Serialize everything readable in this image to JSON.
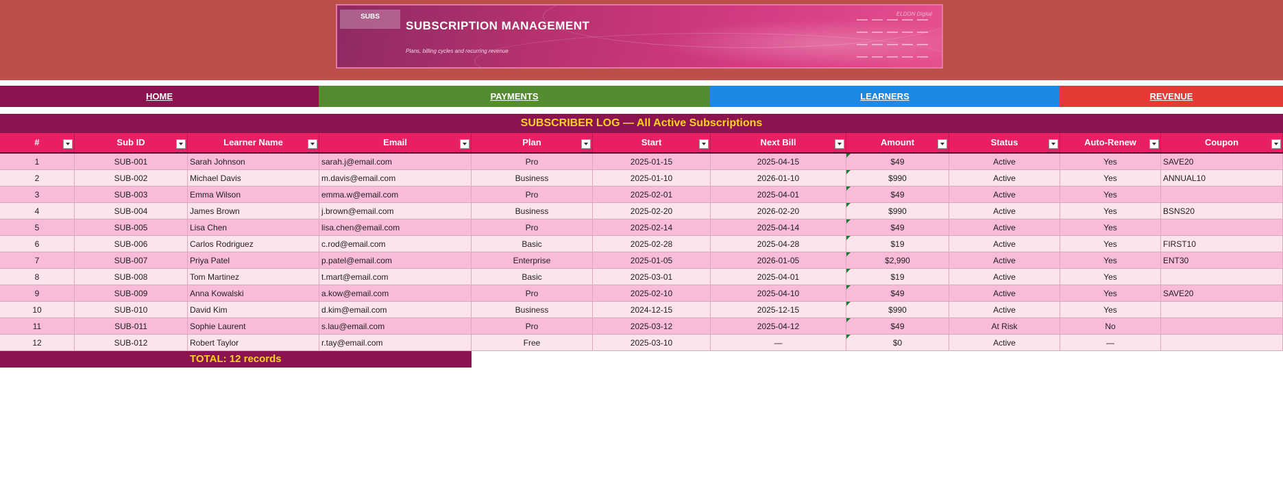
{
  "banner": {
    "badge": "SUBS",
    "title": "SUBSCRIPTION MANAGEMENT",
    "subtitle": "Plans, billing cycles and recurring revenue",
    "brand": "ELDON Digital"
  },
  "nav": {
    "home": "HOME",
    "payments": "PAYMENTS",
    "learners": "LEARNERS",
    "revenue": "REVENUE"
  },
  "colors": {
    "home": "#8b1450",
    "payments": "#548d2f",
    "learners": "#1e88e5",
    "revenue": "#e53935",
    "header": "#e91e63",
    "title_bar": "#8b1450",
    "title_text": "#ffd21e"
  },
  "sheet": {
    "title": "SUBSCRIBER LOG — All Active Subscriptions",
    "columns": [
      "#",
      "Sub ID",
      "Learner Name",
      "Email",
      "Plan",
      "Start",
      "Next Bill",
      "Amount",
      "Status",
      "Auto-Renew",
      "Coupon"
    ],
    "rows": [
      [
        "1",
        "SUB-001",
        "Sarah Johnson",
        "sarah.j@email.com",
        "Pro",
        "2025-01-15",
        "2025-04-15",
        "$49",
        "Active",
        "Yes",
        "SAVE20"
      ],
      [
        "2",
        "SUB-002",
        "Michael Davis",
        "m.davis@email.com",
        "Business",
        "2025-01-10",
        "2026-01-10",
        "$990",
        "Active",
        "Yes",
        "ANNUAL10"
      ],
      [
        "3",
        "SUB-003",
        "Emma Wilson",
        "emma.w@email.com",
        "Pro",
        "2025-02-01",
        "2025-04-01",
        "$49",
        "Active",
        "Yes",
        ""
      ],
      [
        "4",
        "SUB-004",
        "James Brown",
        "j.brown@email.com",
        "Business",
        "2025-02-20",
        "2026-02-20",
        "$990",
        "Active",
        "Yes",
        "BSNS20"
      ],
      [
        "5",
        "SUB-005",
        "Lisa Chen",
        "lisa.chen@email.com",
        "Pro",
        "2025-02-14",
        "2025-04-14",
        "$49",
        "Active",
        "Yes",
        ""
      ],
      [
        "6",
        "SUB-006",
        "Carlos Rodriguez",
        "c.rod@email.com",
        "Basic",
        "2025-02-28",
        "2025-04-28",
        "$19",
        "Active",
        "Yes",
        "FIRST10"
      ],
      [
        "7",
        "SUB-007",
        "Priya Patel",
        "p.patel@email.com",
        "Enterprise",
        "2025-01-05",
        "2026-01-05",
        "$2,990",
        "Active",
        "Yes",
        "ENT30"
      ],
      [
        "8",
        "SUB-008",
        "Tom Martinez",
        "t.mart@email.com",
        "Basic",
        "2025-03-01",
        "2025-04-01",
        "$19",
        "Active",
        "Yes",
        ""
      ],
      [
        "9",
        "SUB-009",
        "Anna Kowalski",
        "a.kow@email.com",
        "Pro",
        "2025-02-10",
        "2025-04-10",
        "$49",
        "Active",
        "Yes",
        "SAVE20"
      ],
      [
        "10",
        "SUB-010",
        "David Kim",
        "d.kim@email.com",
        "Business",
        "2024-12-15",
        "2025-12-15",
        "$990",
        "Active",
        "Yes",
        ""
      ],
      [
        "11",
        "SUB-011",
        "Sophie Laurent",
        "s.lau@email.com",
        "Pro",
        "2025-03-12",
        "2025-04-12",
        "$49",
        "At Risk",
        "No",
        ""
      ],
      [
        "12",
        "SUB-012",
        "Robert Taylor",
        "r.tay@email.com",
        "Free",
        "2025-03-10",
        "—",
        "$0",
        "Active",
        "—",
        ""
      ]
    ],
    "total": "TOTAL: 12 records"
  }
}
